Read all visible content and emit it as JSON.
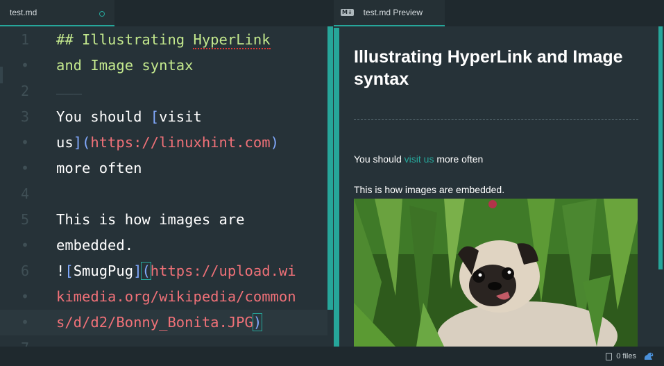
{
  "tabs": {
    "editor_label": "test.md",
    "preview_label": "test.md Preview",
    "preview_icon": "markdown-icon",
    "preview_icon_text": "M↓"
  },
  "editor": {
    "line_numbers": [
      "1",
      "•",
      "2",
      "",
      "3",
      "•",
      "•",
      "4",
      "5",
      "•",
      "6",
      "•",
      "•",
      "7"
    ],
    "lines": {
      "l1_hash": "## Illustrating ",
      "l1_word": "HyperLink",
      "l1b": "and Image syntax",
      "l2_hr": "___",
      "l3_pre": "You should ",
      "l3_br_open": "[",
      "l3_text": "visit",
      "l3b_text": "us",
      "l3b_br_close": "]",
      "l3b_paren_open": "(",
      "l3b_url": "https://linuxhint.com",
      "l3b_paren_close": ")",
      "l3c": "more often",
      "l5a": "This is how images are",
      "l5b": "embedded.",
      "l6_bang": "!",
      "l6_br_open": "[",
      "l6_alt": "SmugPug",
      "l6_br_close": "]",
      "l6_paren_open": "(",
      "l6_url": "https://upload.wi",
      "l6b_url": "kimedia.org/wikipedia/common",
      "l6c_url": "s/d/d2/Bonny_Bonita.JPG",
      "l6c_paren_close": ")"
    }
  },
  "preview": {
    "heading": "Illustrating HyperLink and Image syntax",
    "p1_pre": "You should ",
    "p1_link": "visit us",
    "p1_post": " more often",
    "p2": "This is how images are embedded.",
    "image_alt": "SmugPug"
  },
  "status": {
    "files": "0 files",
    "files_icon": "file-icon",
    "app_icon": "squirrel-icon"
  },
  "colors": {
    "accent": "#26a69a",
    "background": "#263238",
    "heading": "#c3e88d",
    "url": "#f07178",
    "bracket": "#82aaff"
  }
}
